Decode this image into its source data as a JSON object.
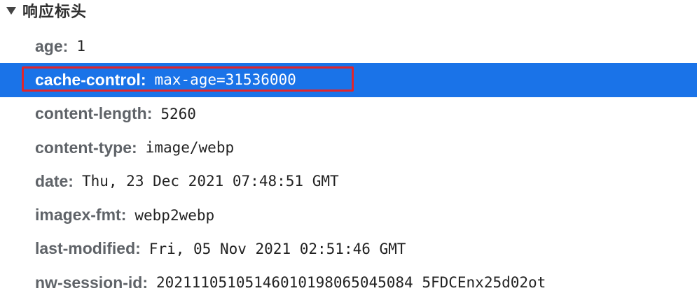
{
  "section": {
    "title": "响应标头",
    "icon": "triangle-down-icon"
  },
  "highlight": {
    "color": "#e0252c",
    "selected_background": "#1a73e8"
  },
  "headers": [
    {
      "name": "age",
      "value": "1"
    },
    {
      "name": "cache-control",
      "value": "max-age=31536000"
    },
    {
      "name": "content-length",
      "value": "5260"
    },
    {
      "name": "content-type",
      "value": "image/webp"
    },
    {
      "name": "date",
      "value": "Thu, 23 Dec 2021 07:48:51 GMT"
    },
    {
      "name": "imagex-fmt",
      "value": "webp2webp"
    },
    {
      "name": "last-modified",
      "value": "Fri, 05 Nov 2021 02:51:46 GMT"
    },
    {
      "name": "nw-session-id",
      "value": "20211105105146010198065045084 5FDCEnx25d02ot"
    }
  ]
}
